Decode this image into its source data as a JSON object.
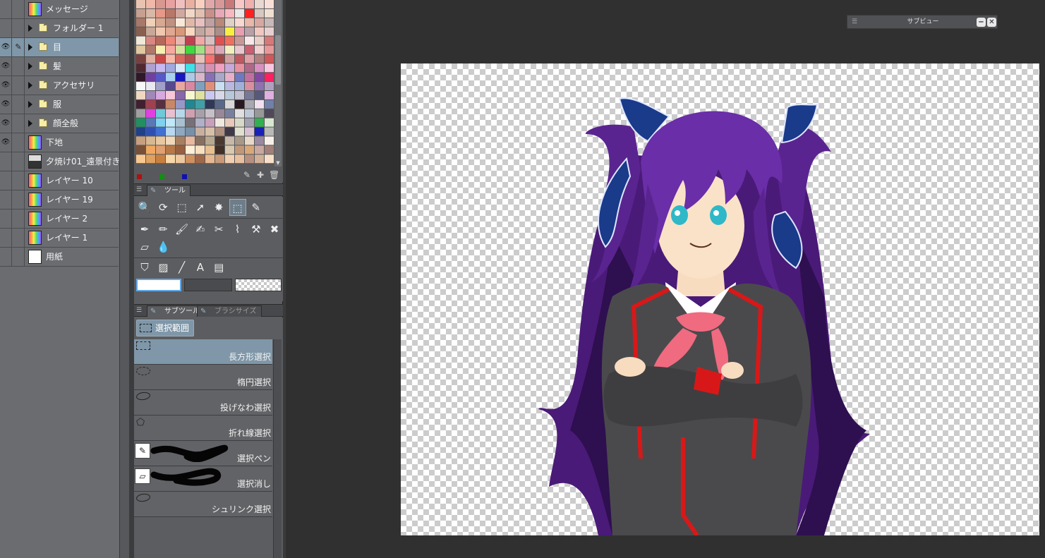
{
  "layers": [
    {
      "name": "メッセージ",
      "type": "raster",
      "visible": false,
      "indent": false
    },
    {
      "name": "フォルダー 1",
      "type": "folder",
      "visible": false,
      "indent": true
    },
    {
      "name": "目",
      "type": "folder",
      "visible": true,
      "indent": true,
      "selected": true,
      "editing": true
    },
    {
      "name": "髪",
      "type": "folder",
      "visible": true,
      "indent": true
    },
    {
      "name": "アクセサリ",
      "type": "folder",
      "visible": true,
      "indent": true
    },
    {
      "name": "服",
      "type": "folder",
      "visible": true,
      "indent": true
    },
    {
      "name": "顔全般",
      "type": "folder",
      "visible": true,
      "indent": true
    },
    {
      "name": "下地",
      "type": "raster",
      "visible": true,
      "indent": false
    },
    {
      "name": "夕焼け01_遠景付き",
      "type": "photo",
      "visible": false,
      "indent": false
    },
    {
      "name": "レイヤー 10",
      "type": "raster",
      "visible": false,
      "indent": false
    },
    {
      "name": "レイヤー 19",
      "type": "raster",
      "visible": false,
      "indent": false
    },
    {
      "name": "レイヤー 2",
      "type": "raster",
      "visible": false,
      "indent": false
    },
    {
      "name": "レイヤー 1",
      "type": "raster",
      "visible": false,
      "indent": false
    },
    {
      "name": "用紙",
      "type": "paper",
      "visible": false,
      "indent": false
    }
  ],
  "palette": {
    "colors": [
      "#e8c4b0",
      "#f0b8a8",
      "#d89890",
      "#e8a0a0",
      "#f0c0c0",
      "#e8b0a0",
      "#f8d0c0",
      "#e0a8a8",
      "#d89898",
      "#c87878",
      "#f8c8c8",
      "#f0b0b0",
      "#e8d8d0",
      "#f8e0d8",
      "#c8a090",
      "#d8b8a8",
      "#e89888",
      "#b87868",
      "#d0a8a0",
      "#f0d8c8",
      "#e0c0b0",
      "#c89088",
      "#e8a8b8",
      "#f8b8c0",
      "#e8e8e8",
      "#ff2020",
      "#d8c8c0",
      "#f0e0d0",
      "#a87868",
      "#f0d0b8",
      "#d8a890",
      "#c09080",
      "#f8e8d8",
      "#e0b8a8",
      "#e8c0c0",
      "#c0a0a0",
      "#b88878",
      "#e0d0c8",
      "#f8d8d0",
      "#e8b8a8",
      "#d8a8a0",
      "#c8b8b8",
      "#886050",
      "#c8a898",
      "#f0c8b0",
      "#e0a890",
      "#d89878",
      "#f8d8c0",
      "#c0a8a0",
      "#d8b0a8",
      "#a89088",
      "#f8f040",
      "#e8a0b0",
      "#b8a0a8",
      "#f0c8c0",
      "#e8d0d0",
      "#f0e8d8",
      "#d88880",
      "#b86858",
      "#f08878",
      "#e8b8b0",
      "#c04050",
      "#f0a8a8",
      "#d8c0c0",
      "#e05050",
      "#f07060",
      "#c89898",
      "#f8e8e8",
      "#e8d0c8",
      "#d87878",
      "#e0c8a0",
      "#b0786a",
      "#f8f0b0",
      "#f8a8a0",
      "#d8e0a0",
      "#40d840",
      "#a0e080",
      "#f0a0a0",
      "#d8a8b8",
      "#f0f0c0",
      "#e8c8d0",
      "#c86070",
      "#f0d0d0",
      "#e89898",
      "#784040",
      "#e0b0a0",
      "#c84848",
      "#f8b8a8",
      "#d86860",
      "#b05050",
      "#e8c0b8",
      "#f87070",
      "#a04848",
      "#d0a0a0",
      "#c05860",
      "#e0a0a8",
      "#b08080",
      "#d05858",
      "#502830",
      "#b0a0d0",
      "#c8b8f0",
      "#a0a8e0",
      "#d8e8f8",
      "#40e0e8",
      "#c0a8c8",
      "#d890b0",
      "#f0a0c0",
      "#c8a8d8",
      "#e890a0",
      "#b06888",
      "#d890c0",
      "#f8c8e0",
      "#301828",
      "#7040a0",
      "#5858c8",
      "#a8d0f0",
      "#1818c0",
      "#b0c8e8",
      "#d8b8c8",
      "#8870b8",
      "#a8a8c8",
      "#e8b0c8",
      "#7078c0",
      "#c070a0",
      "#8048a0",
      "#ff2060",
      "#f8f8f8",
      "#e8e8f0",
      "#a0a0c8",
      "#584890",
      "#e8a8a0",
      "#d888a0",
      "#80a0c0",
      "#e09078",
      "#c8e0f0",
      "#b8b8e0",
      "#a0b0d8",
      "#d890a0",
      "#9070b0",
      "#b0a0c0",
      "#f0d8c0",
      "#a088b8",
      "#d8a8e0",
      "#f8c8d8",
      "#8868a8",
      "#f8f8d0",
      "#e0e0a0",
      "#c8c8f0",
      "#d8d8e8",
      "#b8c8d8",
      "#c0c0d0",
      "#787898",
      "#585878",
      "#e0b0e0",
      "#402030",
      "#a04050",
      "#583040",
      "#c88868",
      "#9898c8",
      "#208890",
      "#40a0a8",
      "#303858",
      "#586888",
      "#d8d8d8",
      "#281820",
      "#a8a8b0",
      "#f0e0f0",
      "#7080a8",
      "#a0a0a0",
      "#e040e0",
      "#70c8d8",
      "#e8c0d0",
      "#b8d8e8",
      "#d0a0b0",
      "#a8a0a8",
      "#c8c0c8",
      "#988898",
      "#7880a0",
      "#e0e0e0",
      "#c0c8d8",
      "#989898",
      "#504858",
      "#209060",
      "#5878b8",
      "#80d0f0",
      "#c0e8f8",
      "#a8c0d0",
      "#787078",
      "#b0b0c8",
      "#c8a0b8",
      "#f0e8e0",
      "#e8c8b8",
      "#d8d8c8",
      "#a0a0b0",
      "#30b050",
      "#d8e8d0",
      "#204088",
      "#3050b0",
      "#4070d0",
      "#b8d8f0",
      "#90a8c0",
      "#7890a8",
      "#c8b0a0",
      "#d8c0a8",
      "#b09080",
      "#403848",
      "#e0e0d0",
      "#d8c0d0",
      "#1820b8",
      "#b8b8b8",
      "#c8a080",
      "#d8b890",
      "#e8c8a0",
      "#f0d8b8",
      "#a88060",
      "#e8b8a0",
      "#887060",
      "#b8a890",
      "#4a3830",
      "#c8b8a8",
      "#a89888",
      "#e8d8c8",
      "#9888a0",
      "#f8f0e8",
      "#785038",
      "#f0a860",
      "#e0a070",
      "#b87848",
      "#986040",
      "#fff0d8",
      "#f8e0c0",
      "#e8c090",
      "#403028",
      "#d8c8b0",
      "#c09878",
      "#d8a878",
      "#c8a8a0",
      "#a08078",
      "#f8c890",
      "#e0a060",
      "#c88040",
      "#f8d8a8",
      "#f0c8a0",
      "#d09060",
      "#a06848",
      "#e8b890",
      "#c89878",
      "#f0d0b0",
      "#e8c0a0",
      "#b89080",
      "#d0b098",
      "#f8e0c8"
    ],
    "rgb_indicators": [
      "#b01010",
      "#109010",
      "#1010b0"
    ]
  },
  "tool_panel": {
    "tab_label": "ツール",
    "row1": [
      "zoom-tool-icon",
      "rotate-tool-icon",
      "object-tool-icon",
      "operation-tool-icon",
      "autoselect-tool-icon",
      "selection-tool-icon",
      "eyedropper-tool-icon"
    ],
    "row1_glyphs": [
      "🔍",
      "⟳",
      "⬚",
      "➚",
      "✸",
      "⬚",
      "✎"
    ],
    "row2": [
      "pen-tool-icon",
      "pencil-tool-icon",
      "brush-tool-icon",
      "airbrush-tool-icon",
      "decoration-tool-icon",
      "blend-tool-icon",
      "correction-tool-icon",
      "ruler-tool-icon"
    ],
    "row2_glyphs": [
      "✒",
      "✏",
      "🖌",
      "✍",
      "✂",
      "⌇",
      "⚒",
      "✖"
    ],
    "row3": [
      "eraser-tool-icon",
      "fill-tool-icon"
    ],
    "row3_glyphs": [
      "▱",
      "💧"
    ],
    "row4": [
      "bucket-tool-icon",
      "gradient-tool-icon",
      "line-tool-icon",
      "text-tool-icon",
      "balloon-tool-icon"
    ],
    "row4_glyphs": [
      "⛉",
      "▨",
      "╱",
      "A",
      "▤"
    ]
  },
  "subtool_panel": {
    "tab_label": "サブツール",
    "inactive_tab_label": "ブラシサイズ",
    "group_button_label": "選択範囲",
    "items": [
      {
        "label": "長方形選択",
        "icon": "rect",
        "selected": true
      },
      {
        "label": "楕円選択",
        "icon": "ellipse"
      },
      {
        "label": "投げなわ選択",
        "icon": "lasso"
      },
      {
        "label": "折れ線選択",
        "icon": "polyline"
      },
      {
        "label": "選択ペン",
        "icon": "pen"
      },
      {
        "label": "選択消し",
        "icon": "erase"
      },
      {
        "label": "シュリンク選択",
        "icon": "shrink"
      }
    ]
  },
  "subview": {
    "title": "サブビュー",
    "minimize_glyph": "−",
    "close_glyph": "✕"
  },
  "colors": {
    "panel_bg": "#6a6c70",
    "selected_bg": "#7f97a8",
    "canvas_bg": "#303030"
  }
}
